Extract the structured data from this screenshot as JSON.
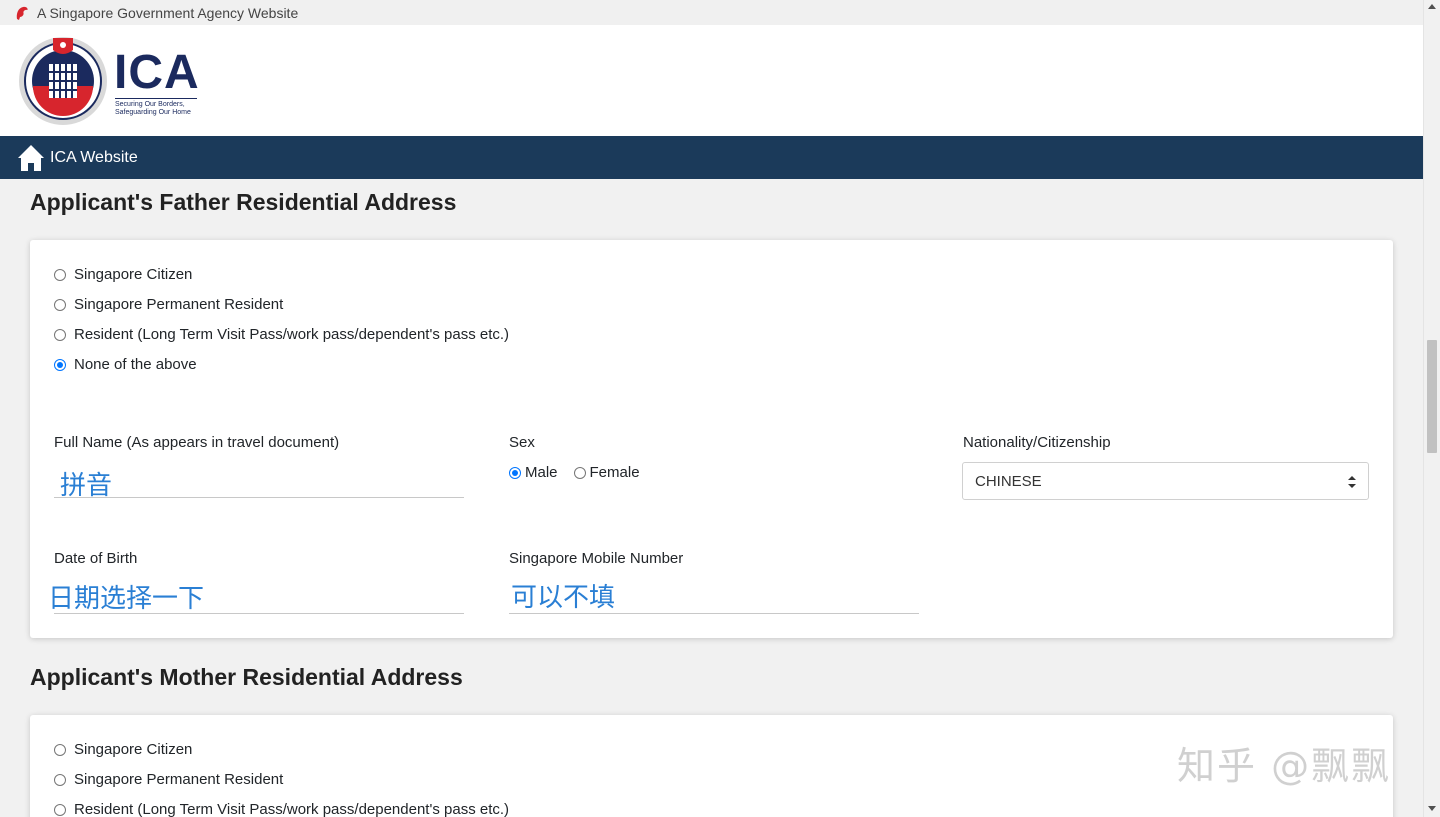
{
  "gov_bar": {
    "text": "A Singapore Government Agency Website"
  },
  "header": {
    "logo_word": "ICA",
    "tagline_line1": "Securing Our Borders,",
    "tagline_line2": "Safeguarding Our Home",
    "brand_color": "#1b2a5e",
    "seal_red": "#d7252d"
  },
  "nav": {
    "home_label": "ICA Website",
    "bar_color": "#1b3a5a"
  },
  "father": {
    "title": "Applicant's Father Residential Address",
    "residency_options": [
      {
        "label": "Singapore Citizen",
        "checked": false
      },
      {
        "label": "Singapore Permanent Resident",
        "checked": false
      },
      {
        "label": "Resident (Long Term Visit Pass/work pass/dependent's pass etc.)",
        "checked": false
      },
      {
        "label": "None of the above",
        "checked": true
      }
    ],
    "full_name": {
      "label": "Full Name (As appears in travel document)",
      "annotation": "拼音"
    },
    "sex": {
      "label": "Sex",
      "options": [
        {
          "label": "Male",
          "checked": true
        },
        {
          "label": "Female",
          "checked": false
        }
      ]
    },
    "nationality": {
      "label": "Nationality/Citizenship",
      "value": "CHINESE"
    },
    "dob": {
      "label": "Date of Birth",
      "annotation": "日期选择一下"
    },
    "mobile": {
      "label": "Singapore Mobile Number",
      "annotation": "可以不填"
    }
  },
  "mother": {
    "title": "Applicant's Mother Residential Address",
    "residency_options": [
      {
        "label": "Singapore Citizen",
        "checked": false
      },
      {
        "label": "Singapore Permanent Resident",
        "checked": false
      },
      {
        "label": "Resident (Long Term Visit Pass/work pass/dependent's pass etc.)",
        "checked": false
      }
    ]
  },
  "watermark": "知乎 @飘飘",
  "accent_color": "#0075ff",
  "annotation_color": "#2a7fd4"
}
